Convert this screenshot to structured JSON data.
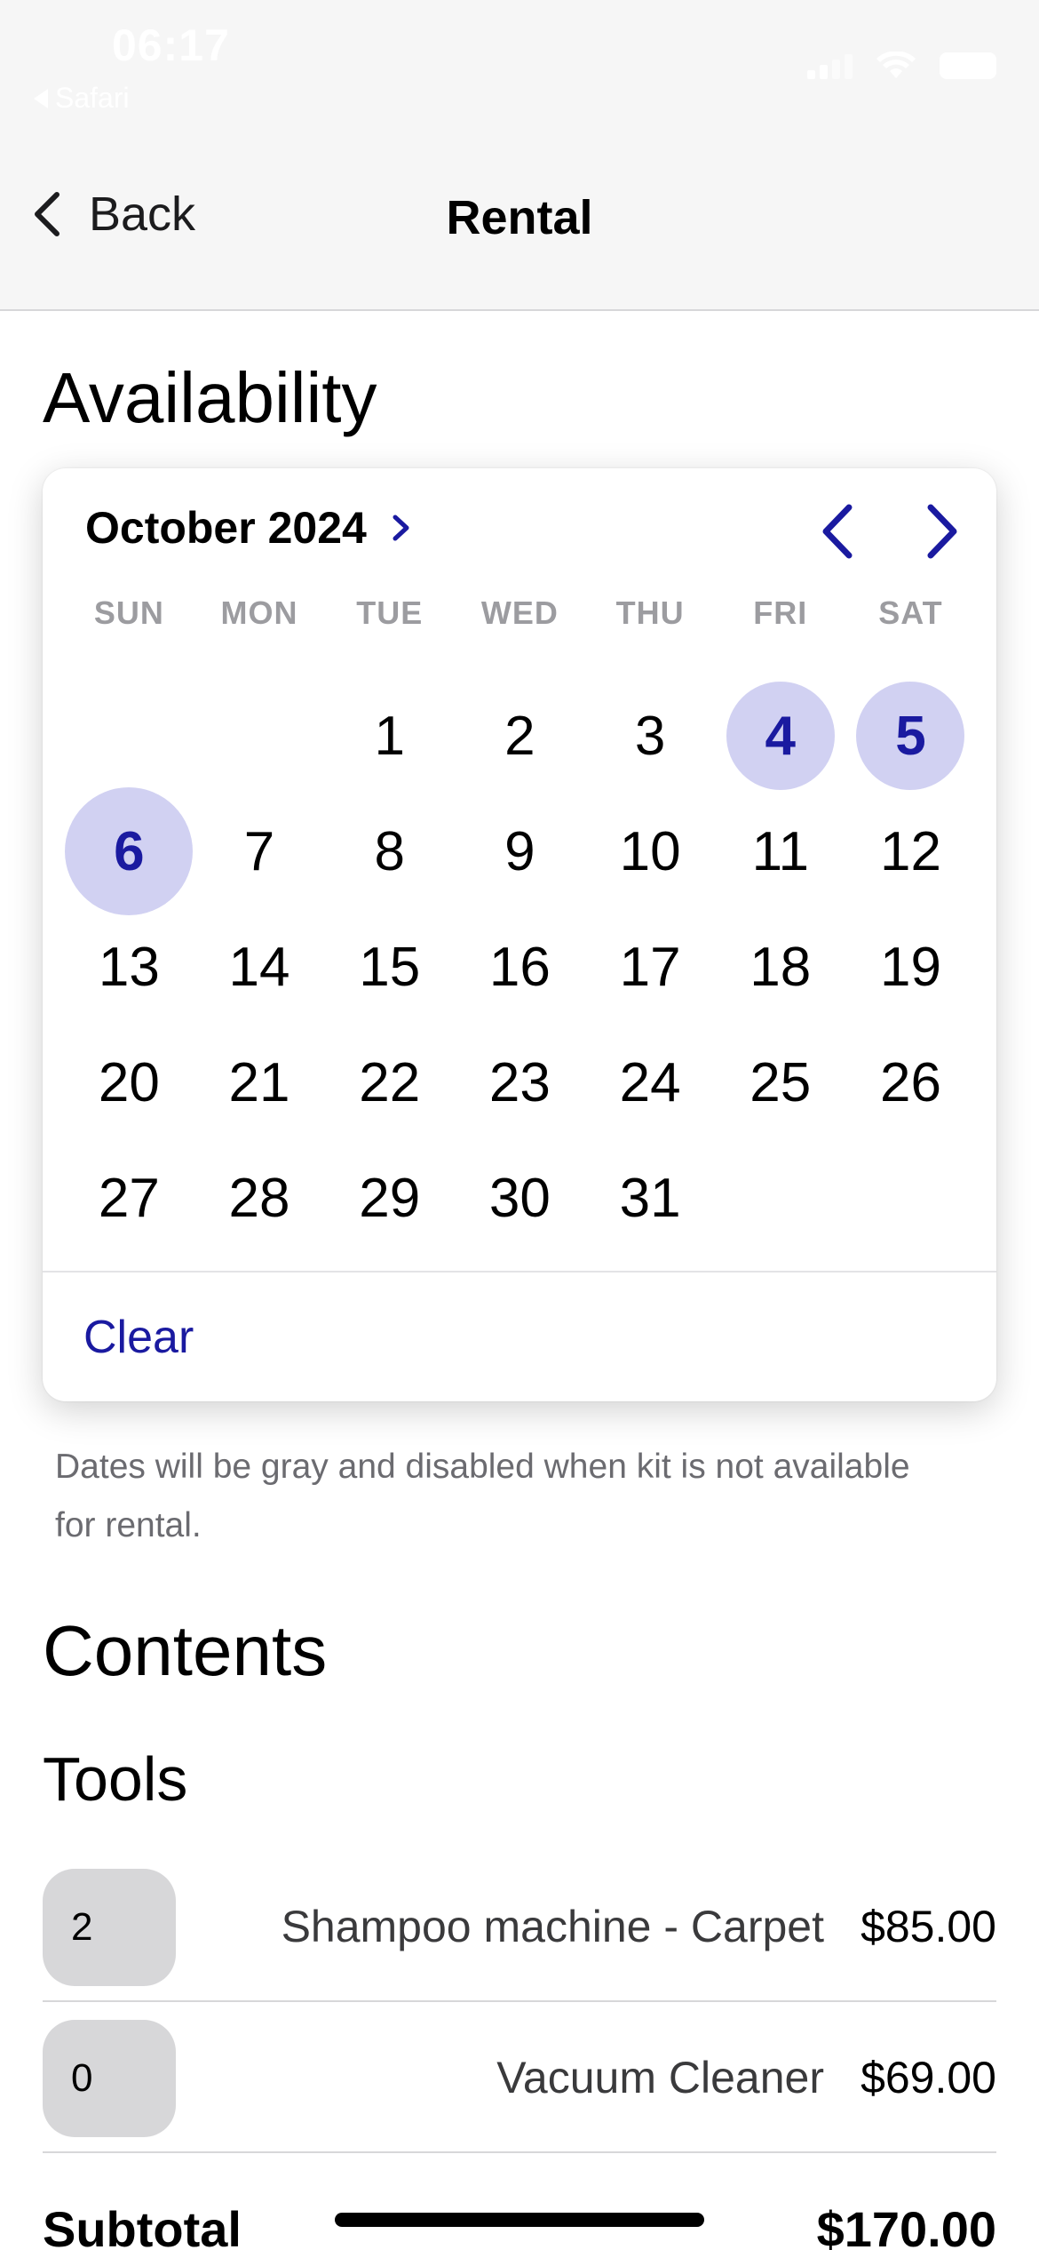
{
  "status_bar": {
    "time": "06:17",
    "back_app": "Safari"
  },
  "nav": {
    "back_label": "Back",
    "title": "Rental"
  },
  "availability": {
    "heading": "Availability",
    "month_label": "October 2024",
    "weekdays": [
      "SUN",
      "MON",
      "TUE",
      "WED",
      "THU",
      "FRI",
      "SAT"
    ],
    "days": [
      "",
      "",
      "1",
      "2",
      "3",
      "4",
      "5",
      "6",
      "7",
      "8",
      "9",
      "10",
      "11",
      "12",
      "13",
      "14",
      "15",
      "16",
      "17",
      "18",
      "19",
      "20",
      "21",
      "22",
      "23",
      "24",
      "25",
      "26",
      "27",
      "28",
      "29",
      "30",
      "31",
      "",
      ""
    ],
    "selected_days": [
      "4",
      "5",
      "6"
    ],
    "clear_label": "Clear",
    "note": "Dates will be gray and disabled when kit is not available for rental."
  },
  "contents": {
    "heading": "Contents",
    "tools_heading": "Tools",
    "tools": [
      {
        "qty": "2",
        "name": "Shampoo machine - Carpet",
        "price": "$85.00"
      },
      {
        "qty": "0",
        "name": "Vacuum Cleaner",
        "price": "$69.00"
      }
    ],
    "subtotal_label": "Subtotal",
    "subtotal_value": "$170.00"
  },
  "colors": {
    "accent": "#1a1aa0",
    "selected_bg": "#d1d1f2",
    "nav_bg": "#f6f6f6"
  },
  "icons": {
    "back": "chevron-left-icon",
    "month_expand": "chevron-right-icon",
    "prev": "chevron-left-icon",
    "next": "chevron-right-icon"
  }
}
